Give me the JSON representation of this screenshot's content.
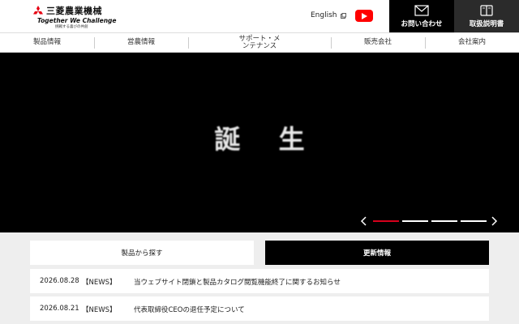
{
  "header": {
    "logo_name": "三菱農業機械",
    "logo_tagline": "Together We Challenge",
    "logo_subtext": "挑戦する喜びの共創",
    "english_link": "English",
    "contact_label": "お問い合わせ",
    "manual_label": "取扱説明書"
  },
  "nav": {
    "items": [
      {
        "label": "製品情報"
      },
      {
        "label": "営農情報"
      },
      {
        "label": "サポート・メンテナンス"
      },
      {
        "label": "販売会社"
      },
      {
        "label": "会社案内"
      }
    ]
  },
  "hero": {
    "title": "誕 生",
    "slides_count": 4,
    "active_slide": 1
  },
  "tabs": {
    "products": "製品から探す",
    "news": "更新情報"
  },
  "news": [
    {
      "date": "2026.08.28",
      "category": "【NEWS】",
      "title": "当ウェブサイト閉鎖と製品カタログ閲覧機能終了に関するお知らせ"
    },
    {
      "date": "2026.08.21",
      "category": "【NEWS】",
      "title": "代表取締役CEOの退任予定について"
    }
  ],
  "colors": {
    "accent": "#d6001c",
    "youtube": "#ff0000",
    "contact_bg": "#000000",
    "manual_bg": "#2b2b2b"
  },
  "icons": [
    "mitsubishi-logo-icon",
    "external-link-icon",
    "youtube-icon",
    "mail-icon",
    "book-icon",
    "chevron-left-icon",
    "chevron-right-icon"
  ]
}
